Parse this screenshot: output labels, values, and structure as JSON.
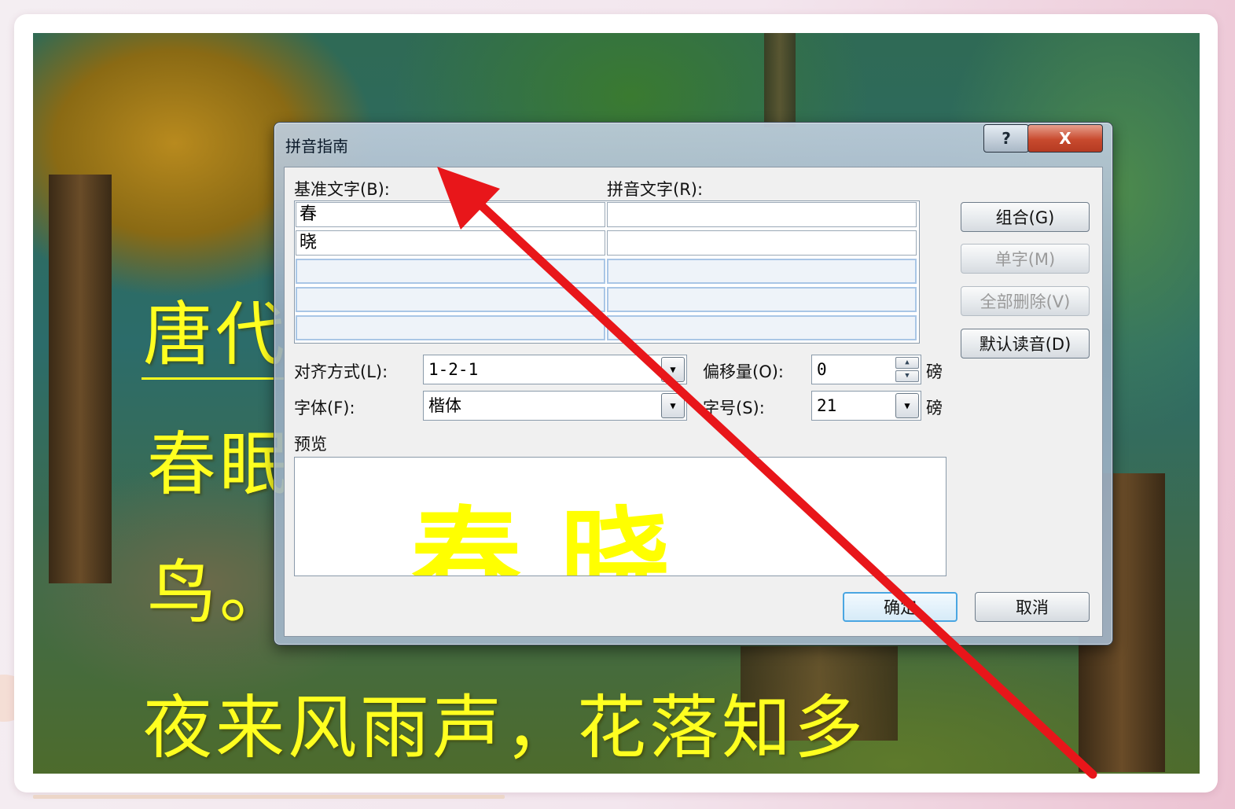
{
  "poem": {
    "line1": "唐代",
    "line2": "春眠",
    "line3": "鸟。",
    "line4": "夜来风雨声，花落知多"
  },
  "dialog": {
    "title": "拼音指南",
    "help_label": "?",
    "close_label": "X",
    "base_text_label": "基准文字(B):",
    "ruby_text_label": "拼音文字(R):",
    "rows": [
      {
        "base": "春",
        "ruby": ""
      },
      {
        "base": "晓",
        "ruby": ""
      },
      {
        "base": "",
        "ruby": ""
      },
      {
        "base": "",
        "ruby": ""
      },
      {
        "base": "",
        "ruby": ""
      }
    ],
    "align_label": "对齐方式(L):",
    "align_value": "1-2-1",
    "offset_label": "偏移量(O):",
    "offset_value": "0",
    "offset_unit": "磅",
    "font_label": "字体(F):",
    "font_value": "楷体",
    "size_label": "字号(S):",
    "size_value": "21",
    "size_unit": "磅",
    "preview_label": "预览",
    "preview_text": "春晓",
    "buttons": {
      "group": "组合(G)",
      "single": "单字(M)",
      "delete_all": "全部删除(V)",
      "default_reading": "默认读音(D)",
      "ok": "确定",
      "cancel": "取消"
    }
  },
  "colors": {
    "poem_text": "#ffff20",
    "annotation_arrow": "#e8161a"
  }
}
